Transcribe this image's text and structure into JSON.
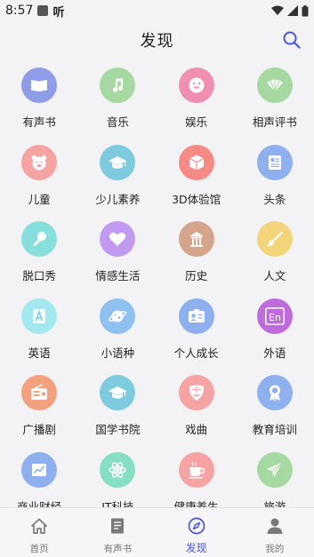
{
  "status_bar": {
    "time": "8:57",
    "app_glyph": "听"
  },
  "header": {
    "title": "发现"
  },
  "categories": [
    {
      "label": "有声书",
      "icon": "book-icon",
      "color": "#8f9ce8"
    },
    {
      "label": "音乐",
      "icon": "music-note-icon",
      "color": "#a6d8a1"
    },
    {
      "label": "娱乐",
      "icon": "smile-icon",
      "color": "#f08fb0"
    },
    {
      "label": "相声评书",
      "icon": "fan-icon",
      "color": "#a6d8a1"
    },
    {
      "label": "儿童",
      "icon": "bear-icon",
      "color": "#f5a3a3"
    },
    {
      "label": "少儿素养",
      "icon": "graduation-cap-icon",
      "color": "#7ecbe0"
    },
    {
      "label": "3D体验馆",
      "icon": "cube-icon",
      "color": "#f58b86"
    },
    {
      "label": "头条",
      "icon": "newspaper-icon",
      "color": "#8fb0ee"
    },
    {
      "label": "脱口秀",
      "icon": "microphone-icon",
      "color": "#87dfdc"
    },
    {
      "label": "情感生活",
      "icon": "heart-icon",
      "color": "#c29bf0"
    },
    {
      "label": "历史",
      "icon": "temple-icon",
      "color": "#d4a58a"
    },
    {
      "label": "人文",
      "icon": "brush-icon",
      "color": "#f2d47a"
    },
    {
      "label": "英语",
      "icon": "letter-a-icon",
      "color": "#a3e8ee"
    },
    {
      "label": "小语种",
      "icon": "planet-icon",
      "color": "#8ec0f0"
    },
    {
      "label": "个人成长",
      "icon": "id-card-icon",
      "color": "#8fb0ee"
    },
    {
      "label": "外语",
      "icon": "en-badge-icon",
      "color": "#c06bdc"
    },
    {
      "label": "广播剧",
      "icon": "radio-icon",
      "color": "#f2a07e"
    },
    {
      "label": "国学书院",
      "icon": "graduation-cap-icon",
      "color": "#7ecbe0"
    },
    {
      "label": "戏曲",
      "icon": "opera-mask-icon",
      "color": "#f5a3a3"
    },
    {
      "label": "教育培训",
      "icon": "award-icon",
      "color": "#8fb0ee"
    },
    {
      "label": "商业财经",
      "icon": "chart-icon",
      "color": "#8fb0ee"
    },
    {
      "label": "IT科技",
      "icon": "atom-icon",
      "color": "#86dfc4"
    },
    {
      "label": "健康养生",
      "icon": "teacup-icon",
      "color": "#f5a3a3"
    },
    {
      "label": "旅游",
      "icon": "airplane-icon",
      "color": "#a6d8a1"
    }
  ],
  "tabbar": {
    "tabs": [
      {
        "label": "首页",
        "icon": "home-icon",
        "active": false
      },
      {
        "label": "有声书",
        "icon": "audiobook-icon",
        "active": false
      },
      {
        "label": "发现",
        "icon": "compass-icon",
        "active": true
      },
      {
        "label": "我的",
        "icon": "user-icon",
        "active": false
      }
    ],
    "active_color": "#4a56d8",
    "inactive_color": "#7a7a7a"
  }
}
